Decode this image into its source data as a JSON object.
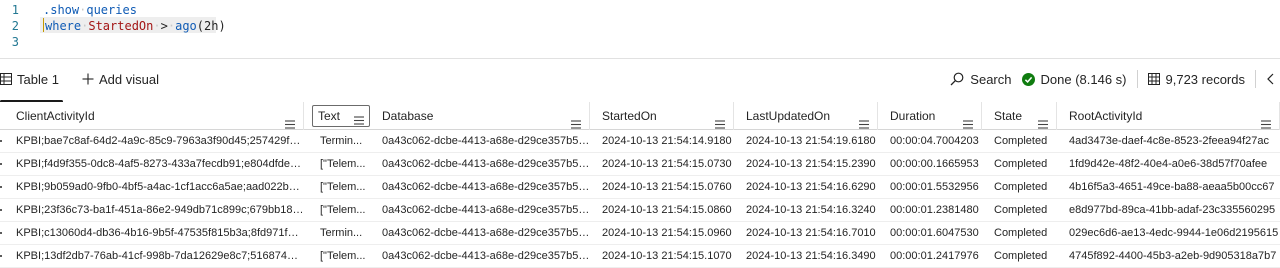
{
  "editor": {
    "lines": [
      {
        "num": "1",
        "tokens": [
          {
            "t": ".show",
            "c": "kw"
          },
          {
            "t": "·",
            "c": "sp"
          },
          {
            "t": "queries",
            "c": "kw"
          }
        ]
      },
      {
        "num": "2",
        "tokens": [
          {
            "t": "|",
            "c": "cursor"
          },
          {
            "t": "where",
            "c": "kw"
          },
          {
            "t": "·",
            "c": "sp"
          },
          {
            "t": "StartedOn",
            "c": "fn"
          },
          {
            "t": "·",
            "c": "sp"
          },
          {
            "t": ">",
            "c": "plain"
          },
          {
            "t": "·",
            "c": "sp"
          },
          {
            "t": "ago",
            "c": "kw"
          },
          {
            "t": "(2h)",
            "c": "plain"
          }
        ]
      },
      {
        "num": "3",
        "tokens": []
      }
    ]
  },
  "toolbar": {
    "table_tab": "Table 1",
    "add_visual": "Add visual",
    "search": "Search",
    "status": "Done (8.146 s)",
    "records": "9,723 records"
  },
  "grid": {
    "columns": [
      "ClientActivityId",
      "Text",
      "Database",
      "StartedOn",
      "LastUpdatedOn",
      "Duration",
      "State",
      "RootActivityId"
    ],
    "rows": [
      [
        "KPBI;bae7c8af-64d2-4a9c-85c9-7963a3f90d45;257429f0-28...",
        "Termin...",
        "0a43c062-dcbe-4413-a68e-d29ce357b50b",
        "2024-10-13 21:54:14.9180",
        "2024-10-13 21:54:19.6180",
        "00:00:04.7004203",
        "Completed",
        "4ad3473e-daef-4c8e-8523-2feea94f27ac"
      ],
      [
        "KPBI;f4d9f355-0dc8-4af5-8273-433a7fecdb91;e804dfde-84...",
        "[\"Telem...",
        "0a43c062-dcbe-4413-a68e-d29ce357b50b",
        "2024-10-13 21:54:15.0730",
        "2024-10-13 21:54:15.2390",
        "00:00:00.1665953",
        "Completed",
        "1fd9d42e-48f2-40e4-a0e6-38d57f70afee"
      ],
      [
        "KPBI;9b059ad0-9fb0-4bf5-a4ac-1cf1acc6a5ae;aad022b6-47...",
        "[\"Telem...",
        "0a43c062-dcbe-4413-a68e-d29ce357b50b",
        "2024-10-13 21:54:15.0760",
        "2024-10-13 21:54:16.6290",
        "00:00:01.5532956",
        "Completed",
        "4b16f5a3-4651-49ce-ba88-aeaa5b00cc67"
      ],
      [
        "KPBI;23f36c73-ba1f-451a-86e2-949db71c899c;679bb18e-7...",
        "[\"Telem...",
        "0a43c062-dcbe-4413-a68e-d29ce357b50b",
        "2024-10-13 21:54:15.0860",
        "2024-10-13 21:54:16.3240",
        "00:00:01.2381480",
        "Completed",
        "e8d977bd-89ca-41bb-adaf-23c335560295"
      ],
      [
        "KPBI;c13060d4-db36-4b16-9b5f-47535f815b3a;8fd971f8-50...",
        "Termin...",
        "0a43c062-dcbe-4413-a68e-d29ce357b50b",
        "2024-10-13 21:54:15.0960",
        "2024-10-13 21:54:16.7010",
        "00:00:01.6047530",
        "Completed",
        "029ec6d6-ae13-4edc-9944-1e06d2195615"
      ],
      [
        "KPBI;13df2db7-76ab-41cf-998b-7da12629e8c7;516874da-6...",
        "[\"Telem...",
        "0a43c062-dcbe-4413-a68e-d29ce357b50b",
        "2024-10-13 21:54:15.1070",
        "2024-10-13 21:54:16.3490",
        "00:00:01.2417976",
        "Completed",
        "4745f892-4400-45b3-a2eb-9d905318a7b7"
      ]
    ]
  }
}
